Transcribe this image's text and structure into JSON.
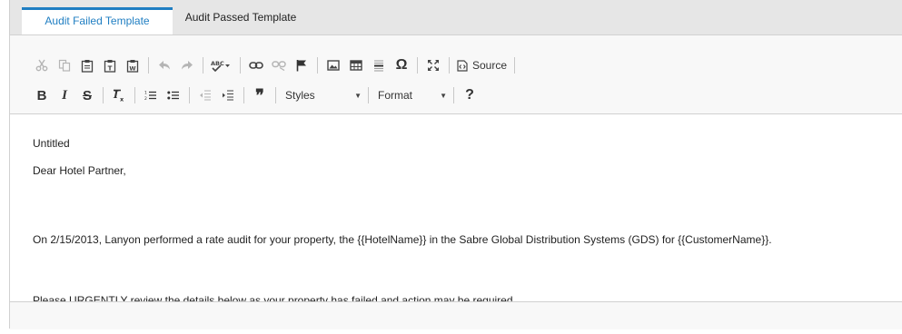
{
  "tabs": [
    {
      "label": "Audit Failed Template",
      "active": true
    },
    {
      "label": "Audit Passed Template",
      "active": false
    }
  ],
  "toolbar": {
    "row1": [
      "cut-icon",
      "copy-icon",
      "paste-icon",
      "paste-text-icon",
      "paste-word-icon",
      "undo-icon",
      "redo-icon",
      "spellcheck-icon",
      "link-icon",
      "unlink-icon",
      "anchor-icon",
      "image-icon",
      "table-icon",
      "horizontal-line-icon",
      "special-char-icon",
      "maximize-icon",
      "source-icon"
    ],
    "source_label": "Source",
    "styles_label": "Styles",
    "format_label": "Format",
    "help_label": "?",
    "bold_label": "B",
    "italic_label": "I",
    "strike_label": "S",
    "blockquote_label": "❞"
  },
  "content": {
    "line1": "Untitled",
    "line2": "Dear Hotel Partner,",
    "line3": "On 2/15/2013, Lanyon performed a rate audit for your property, the {{HotelName}} in the Sabre Global Distribution Systems (GDS) for {{CustomerName}}.",
    "line4": "Please URGENTLY review the details below as your property has failed and action may be required."
  },
  "colors": {
    "accent": "#1f7ec2",
    "tabbar": "#e6e6e6",
    "toolbar": "#f8f8f8"
  }
}
